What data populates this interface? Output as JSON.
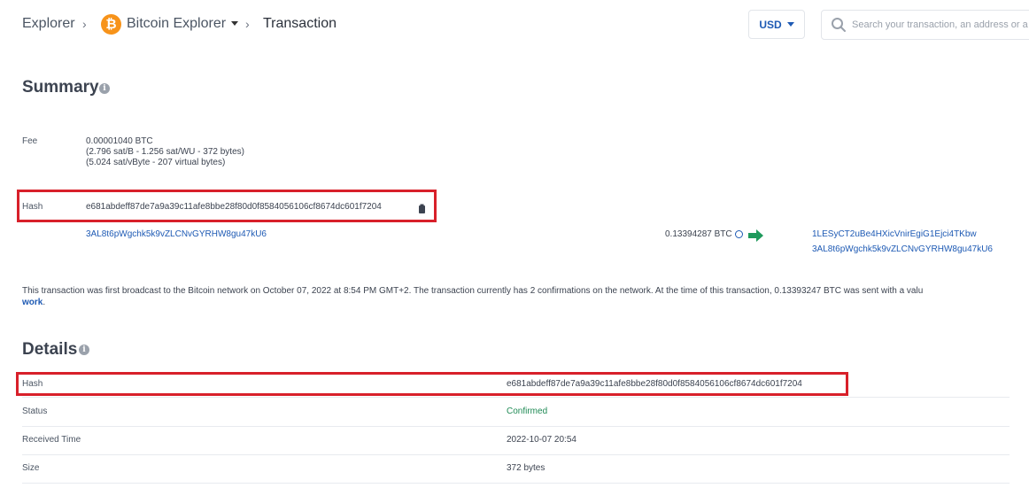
{
  "breadcrumb": {
    "explorer": "Explorer",
    "bitcoin_explorer": "Bitcoin Explorer",
    "transaction": "Transaction",
    "coin_symbol": "₿"
  },
  "currency": {
    "selected": "USD"
  },
  "search": {
    "placeholder": "Search your transaction, an address or a block"
  },
  "summary": {
    "title": "Summary",
    "fee": {
      "label": "Fee",
      "line1": "0.00001040 BTC",
      "line2": "(2.796 sat/B - 1.256 sat/WU - 372 bytes)",
      "line3": "(5.024 sat/vByte - 207 virtual bytes)"
    },
    "hash": {
      "label": "Hash",
      "value": "e681abdeff87de7a9a39c11afe8bbe28f80d0f8584056106cf8674dc601f7204"
    },
    "input_address": "3AL8t6pWgchk5k9vZLCNvGYRHW8gu47kU6",
    "input_amount": "0.13394287 BTC",
    "outputs": [
      "1LESyCT2uBe4HXicVnirEgiG1Ejci4TKbw",
      "3AL8t6pWgchk5k9vZLCNvGYRHW8gu47kU6"
    ],
    "broadcast_text": "This transaction was first broadcast to the Bitcoin network on October 07, 2022 at 8:54 PM GMT+2.  The transaction currently has 2 confirmations on the network.  At the time of this transaction, 0.13393247 BTC was sent with a valu",
    "broadcast_link": "work",
    "broadcast_end": "."
  },
  "details": {
    "title": "Details",
    "rows": [
      {
        "label": "Hash",
        "value": "e681abdeff87de7a9a39c11afe8bbe28f80d0f8584056106cf8674dc601f7204"
      },
      {
        "label": "Status",
        "value": "Confirmed"
      },
      {
        "label": "Received Time",
        "value": "2022-10-07 20:54"
      },
      {
        "label": "Size",
        "value": "372 bytes"
      }
    ]
  },
  "colors": {
    "accent_blue": "#1e5ab4",
    "bitcoin_orange": "#f7931a",
    "highlight_red": "#d8202a",
    "confirmed_green": "#1f8a55"
  },
  "icons": [
    "bitcoin-logo-icon",
    "chevron-right-icon",
    "caret-down-icon",
    "search-icon",
    "info-icon",
    "copy-icon",
    "globe-icon",
    "arrow-right-icon"
  ]
}
